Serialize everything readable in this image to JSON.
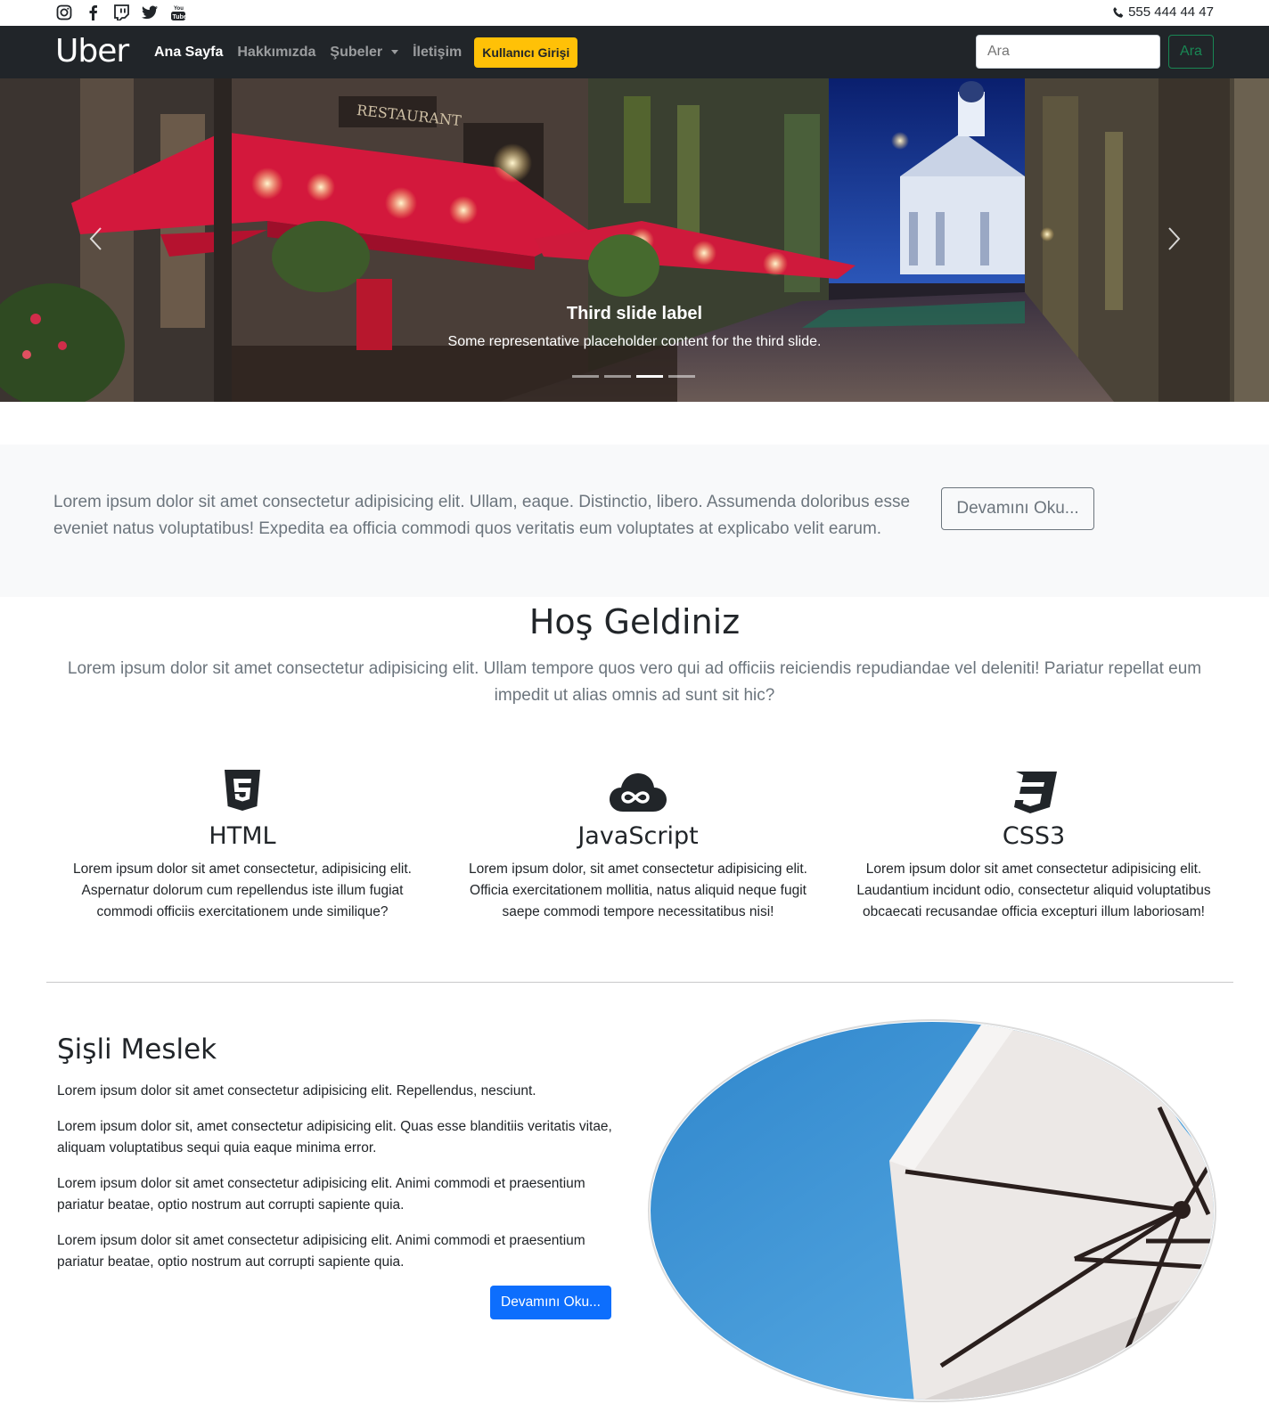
{
  "topbar": {
    "social_icons": [
      "instagram-icon",
      "facebook-icon",
      "twitch-icon",
      "twitter-icon",
      "youtube-icon"
    ],
    "phone": "555 444 44 47"
  },
  "navbar": {
    "brand": "Uber",
    "links": [
      {
        "label": "Ana Sayfa",
        "active": true
      },
      {
        "label": "Hakkımızda",
        "active": false
      },
      {
        "label": "Şubeler",
        "active": false,
        "dropdown": true
      },
      {
        "label": "İletişim",
        "active": false
      }
    ],
    "login_button": "Kullanıcı Girişi",
    "search_placeholder": "Ara",
    "search_button": "Ara"
  },
  "carousel": {
    "caption_title": "Third slide label",
    "caption_text": "Some representative placeholder content for the third slide.",
    "indicators": 4,
    "active_indicator": 3,
    "sign_text": "RESTAURANT"
  },
  "lead": {
    "text": "Lorem ipsum dolor sit amet consectetur adipisicing elit. Ullam, eaque. Distinctio, libero. Assumenda doloribus esse eveniet natus voluptatibus! Expedita ea officia commodi quos veritatis eum voluptates at explicabo velit earum.",
    "button": "Devamını Oku..."
  },
  "welcome": {
    "title": "Hoş Geldiniz",
    "text": "Lorem ipsum dolor sit amet consectetur adipisicing elit. Ullam tempore quos vero qui ad officiis reiciendis repudiandae vel deleniti! Pariatur repellat eum impedit ut alias omnis ad sunt sit hic?"
  },
  "features": [
    {
      "icon": "html5-icon",
      "title": "HTML",
      "text": "Lorem ipsum dolor sit amet consectetur, adipisicing elit. Aspernatur dolorum cum repellendus iste illum fugiat commodi officiis exercitationem unde similique?"
    },
    {
      "icon": "cloud-infinity-icon",
      "title": "JavaScript",
      "text": "Lorem ipsum dolor, sit amet consectetur adipisicing elit. Officia exercitationem mollitia, natus aliquid neque fugit saepe commodi tempore necessitatibus nisi!"
    },
    {
      "icon": "css3-icon",
      "title": "CSS3",
      "text": "Lorem ipsum dolor sit amet consectetur adipisicing elit. Laudantium incidunt odio, consectetur aliquid voluptatibus obcaecati recusandae officia excepturi illum laboriosam!"
    }
  ],
  "sisli": {
    "title": "Şişli Meslek",
    "paragraphs": [
      "Lorem ipsum dolor sit amet consectetur adipisicing elit. Repellendus, nesciunt.",
      "Lorem ipsum dolor sit, amet consectetur adipisicing elit. Quas esse blanditiis veritatis vitae, aliquam voluptatibus sequi quia eaque minima error.",
      "Lorem ipsum dolor sit amet consectetur adipisicing elit. Animi commodi et praesentium pariatur beatae, optio nostrum aut corrupti sapiente quia.",
      "Lorem ipsum dolor sit amet consectetur adipisicing elit. Animi commodi et praesentium pariatur beatae, optio nostrum aut corrupti sapiente quia."
    ],
    "button": "Devamını Oku..."
  },
  "colors": {
    "navbar_bg": "#212529",
    "login_button": "#ffc107",
    "search_button": "#198754",
    "primary_button": "#0d6efd",
    "lead_bg": "#f8f9fa",
    "muted_text": "#6c757d"
  }
}
